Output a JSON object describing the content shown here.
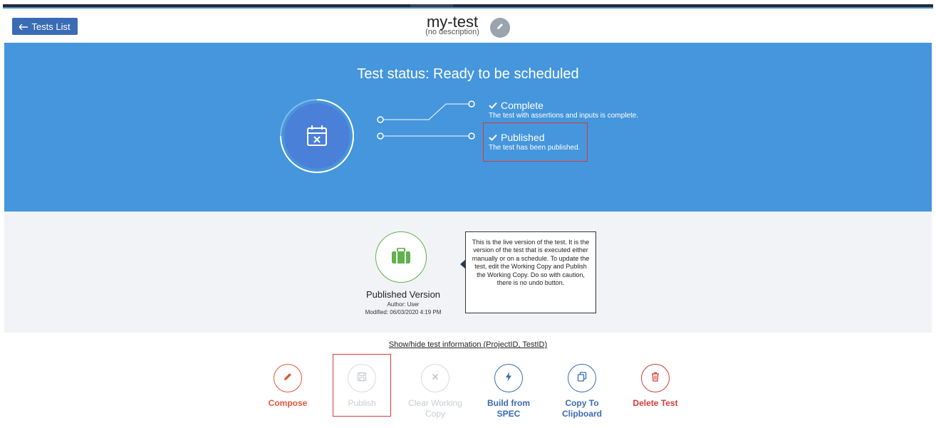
{
  "header": {
    "back_label": "Tests List",
    "test_name": "my-test",
    "test_description": "(no description)"
  },
  "status": {
    "title": "Test status: Ready to be scheduled",
    "steps": [
      {
        "label": "Complete",
        "detail": "The test with assertions and inputs is complete."
      },
      {
        "label": "Published",
        "detail": "The test has been published."
      }
    ]
  },
  "version": {
    "title": "Published Version",
    "author": "Author: User",
    "modified": "Modified: 06/03/2020 4:19 PM",
    "tooltip": "This is the live version of the test. It is the version of the test that is executed either manually or on a schedule. To update the test, edit the Working Copy and Publish the Working Copy. Do so with caution, there is no undo button."
  },
  "info_link": "Show/hide test information (ProjectID, TestID)",
  "actions": {
    "compose": "Compose",
    "publish": "Publish",
    "clear": "Clear Working Copy",
    "build": "Build from SPEC",
    "copy": "Copy To Clipboard",
    "delete": "Delete Test"
  },
  "colors": {
    "status_bg": "#4596dc",
    "back_button": "#3a6bb5",
    "compose": "#e8553a",
    "delete": "#d93a3a",
    "published_green": "#5eb34a",
    "highlight": "#d93a3a"
  },
  "icons": {
    "status": "calendar-x-icon",
    "version": "briefcase-icon",
    "compose": "pencil-icon",
    "publish": "save-icon",
    "clear": "x-icon",
    "build": "lightning-icon",
    "copy": "clipboard-icon",
    "delete": "trash-icon"
  }
}
